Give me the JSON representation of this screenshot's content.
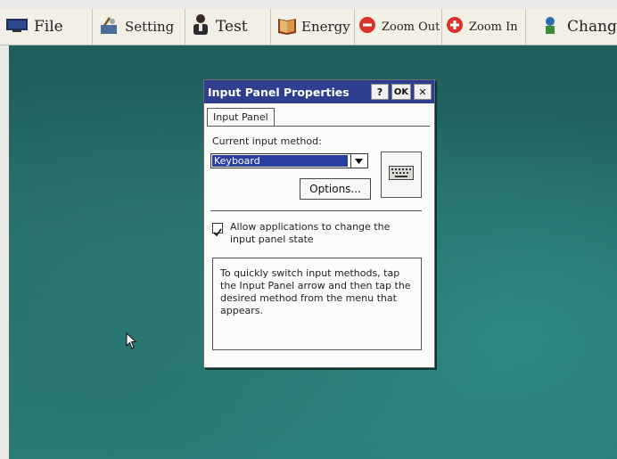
{
  "toolbar": {
    "items": [
      {
        "label": "File",
        "icon": "monitor-icon"
      },
      {
        "label": "Setting",
        "icon": "tools-icon"
      },
      {
        "label": "Test",
        "icon": "person-icon"
      },
      {
        "label": "Energy",
        "icon": "book-icon"
      },
      {
        "label": "Zoom Out",
        "icon": "zoom-out-icon"
      },
      {
        "label": "Zoom In",
        "icon": "zoom-in-icon"
      },
      {
        "label": "Chang",
        "icon": "swap-icon"
      }
    ]
  },
  "dialog": {
    "title": "Input Panel Properties",
    "help_button": "?",
    "ok_button": "OK",
    "close_button": "✕",
    "tab_label": "Input Panel",
    "method_label": "Current input method:",
    "method_value": "Keyboard",
    "options_button": "Options...",
    "allow_checked": true,
    "allow_label": "Allow applications to change the input panel state",
    "help_text": "To quickly switch input methods, tap the Input Panel arrow and then tap the desired method from the menu that appears."
  },
  "colors": {
    "titlebar": "#2f3e8f",
    "desktop": "#246b68",
    "selection": "#2a3fa0"
  }
}
